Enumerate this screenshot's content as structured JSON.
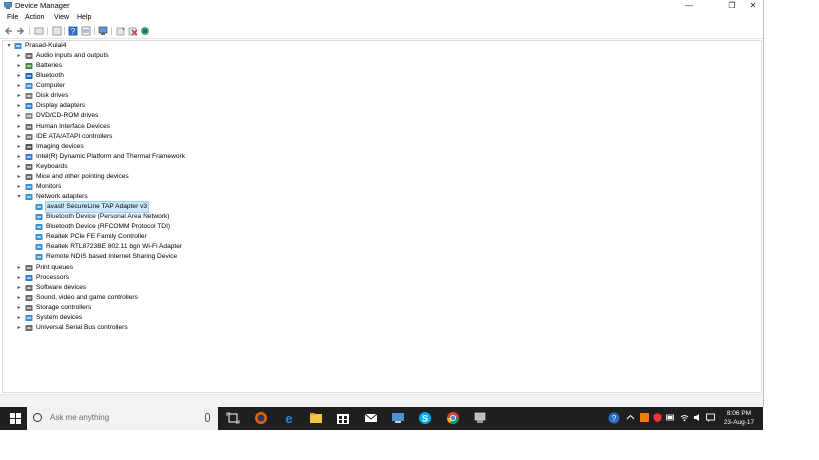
{
  "window": {
    "title": "Device Manager",
    "controls": {
      "minimize": "—",
      "maximize": "❐",
      "close": "✕"
    }
  },
  "menu": [
    "File",
    "Action",
    "View",
    "Help"
  ],
  "toolbar": [
    "back-icon",
    "forward-icon",
    "properties-sheet-icon",
    "update-view-icon",
    "help-icon",
    "details-icon",
    "display-icon",
    "update-driver-icon",
    "uninstall-icon",
    "scan-hardware-icon"
  ],
  "tree": {
    "root": "Prasad-Kulal4",
    "categories": [
      {
        "label": "Audio inputs and outputs",
        "icon": "speaker-icon",
        "color": "#6b6b6b"
      },
      {
        "label": "Batteries",
        "icon": "battery-icon",
        "color": "#3d8a3d"
      },
      {
        "label": "Bluetooth",
        "icon": "bluetooth-icon",
        "color": "#1565c0"
      },
      {
        "label": "Computer",
        "icon": "computer-icon",
        "color": "#3a8ed4"
      },
      {
        "label": "Disk drives",
        "icon": "disk-drive-icon",
        "color": "#7a7a7a"
      },
      {
        "label": "Display adapters",
        "icon": "display-adapter-icon",
        "color": "#2f7fcf"
      },
      {
        "label": "DVD/CD-ROM drives",
        "icon": "dvd-drive-icon",
        "color": "#8a8a8a"
      },
      {
        "label": "Human Interface Devices",
        "icon": "hid-icon",
        "color": "#6f6f6f"
      },
      {
        "label": "IDE ATA/ATAPI controllers",
        "icon": "ide-controller-icon",
        "color": "#7a7a7a"
      },
      {
        "label": "Imaging devices",
        "icon": "camera-icon",
        "color": "#555555"
      },
      {
        "label": "Intel(R) Dynamic Platform and Thermal Framework",
        "icon": "chip-icon",
        "color": "#2f7fcf"
      },
      {
        "label": "Keyboards",
        "icon": "keyboard-icon",
        "color": "#6b6b6b"
      },
      {
        "label": "Mice and other pointing devices",
        "icon": "mouse-icon",
        "color": "#6b6b6b"
      },
      {
        "label": "Monitors",
        "icon": "monitor-icon",
        "color": "#3a8ed4"
      },
      {
        "label": "Network adapters",
        "icon": "network-adapter-icon",
        "color": "#3a8ed4",
        "expanded": true,
        "children": [
          {
            "label": "avast! SecureLine TAP Adapter v3",
            "icon": "network-adapter-icon",
            "selected": true
          },
          {
            "label": "Bluetooth Device (Personal Area Network)",
            "icon": "network-adapter-icon"
          },
          {
            "label": "Bluetooth Device (RFCOMM Protocol TDI)",
            "icon": "network-adapter-icon"
          },
          {
            "label": "Realtek PCIe FE Family Controller",
            "icon": "network-adapter-icon"
          },
          {
            "label": "Realtek RTL8723BE 802.11 bgn Wi-Fi Adapter",
            "icon": "network-adapter-icon"
          },
          {
            "label": "Remote NDIS based Internet Sharing Device",
            "icon": "network-adapter-icon"
          }
        ]
      },
      {
        "label": "Print queues",
        "icon": "printer-icon",
        "color": "#6b6b6b"
      },
      {
        "label": "Processors",
        "icon": "processor-icon",
        "color": "#2f7fcf"
      },
      {
        "label": "Software devices",
        "icon": "software-device-icon",
        "color": "#6b6b6b"
      },
      {
        "label": "Sound, video and game controllers",
        "icon": "sound-controller-icon",
        "color": "#6b6b6b"
      },
      {
        "label": "Storage controllers",
        "icon": "storage-controller-icon",
        "color": "#6b6b6b"
      },
      {
        "label": "System devices",
        "icon": "system-device-icon",
        "color": "#3a8ed4"
      },
      {
        "label": "Universal Serial Bus controllers",
        "icon": "usb-icon",
        "color": "#6b6b6b"
      }
    ]
  },
  "taskbar": {
    "search_placeholder": "Ask me anything",
    "apps": [
      "task-view-icon",
      "firefox-icon",
      "edge-icon",
      "file-explorer-icon",
      "store-icon",
      "mail-icon",
      "remote-desktop-icon",
      "skype-icon",
      "chrome-icon",
      "device-manager-icon"
    ],
    "clock_time": "8:06 PM",
    "clock_date": "23-Aug-17"
  }
}
